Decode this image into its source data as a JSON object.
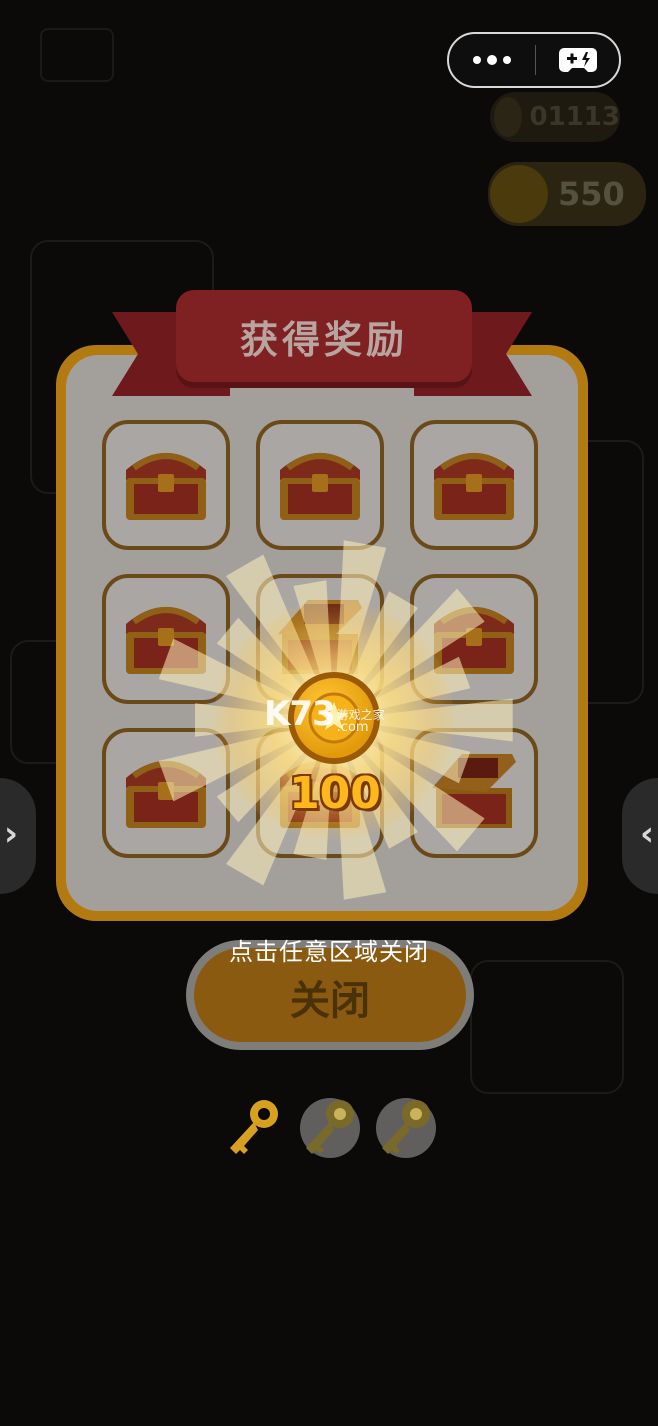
{
  "hud": {
    "timer": "01113",
    "coins": "550"
  },
  "reward_dialog": {
    "title": "获得奖励",
    "reward_amount": "100",
    "close_hint": "点击任意区域关闭",
    "close_button": "关闭",
    "chests": [
      {
        "state": "closed"
      },
      {
        "state": "closed"
      },
      {
        "state": "closed"
      },
      {
        "state": "closed"
      },
      {
        "state": "opened"
      },
      {
        "state": "closed"
      },
      {
        "state": "closed"
      },
      {
        "state": "closed"
      },
      {
        "state": "opened"
      }
    ]
  },
  "keys": {
    "total": 3,
    "used": 1
  },
  "watermark": {
    "logo": "K73",
    "tagline": "游戏之家",
    "domain": ".com"
  },
  "colors": {
    "panel_gold": "#b47a12",
    "ribbon_red": "#7f2023",
    "reward_gold": "#ffb81c",
    "key_gold": "#d8a020"
  },
  "icons": {
    "menu": "more-dots-icon",
    "game": "gamepad-icon",
    "chest": "treasure-chest-icon",
    "coin": "coin-icon",
    "key": "key-icon",
    "nav_left": "chevron-right-icon",
    "nav_right": "chevron-left-icon"
  }
}
